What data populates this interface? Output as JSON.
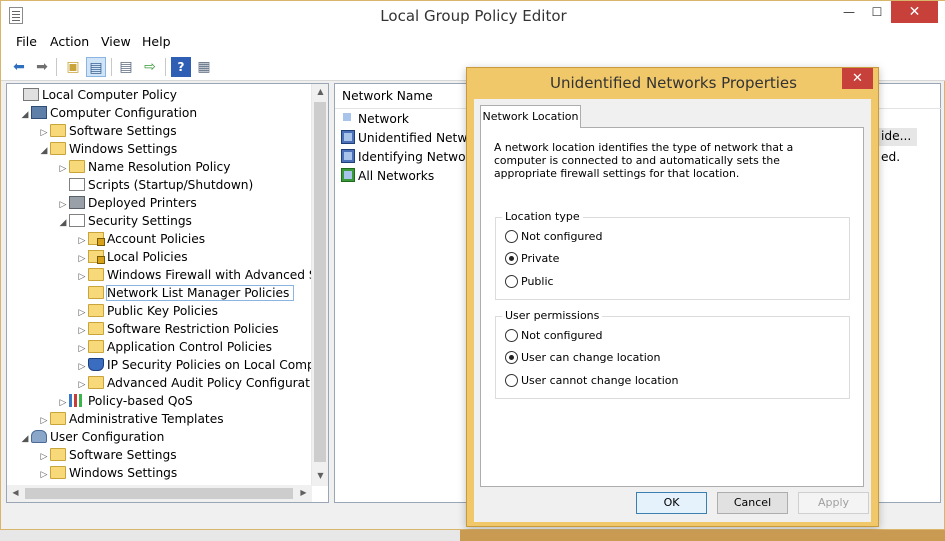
{
  "app": {
    "title": "Local Group Policy Editor",
    "min": "—",
    "max": "☐",
    "close": "✕"
  },
  "menu": [
    "File",
    "Action",
    "View",
    "Help"
  ],
  "tree": {
    "items": [
      {
        "label": "Local Computer Policy",
        "level": 0,
        "arrow": "",
        "icon": "lgp"
      },
      {
        "label": "Computer Configuration",
        "level": 1,
        "arrow": "◢",
        "icon": "computer"
      },
      {
        "label": "Software Settings",
        "level": 2,
        "arrow": "▷",
        "icon": "folder"
      },
      {
        "label": "Windows Settings",
        "level": 2,
        "arrow": "◢",
        "icon": "folder"
      },
      {
        "label": "Name Resolution Policy",
        "level": 3,
        "arrow": "▷",
        "icon": "folder"
      },
      {
        "label": "Scripts (Startup/Shutdown)",
        "level": 3,
        "arrow": "",
        "icon": "doc"
      },
      {
        "label": "Deployed Printers",
        "level": 3,
        "arrow": "▷",
        "icon": "printer"
      },
      {
        "label": "Security Settings",
        "level": 3,
        "arrow": "◢",
        "icon": "doc"
      },
      {
        "label": "Account Policies",
        "level": 4,
        "arrow": "▷",
        "icon": "folder-lock"
      },
      {
        "label": "Local Policies",
        "level": 4,
        "arrow": "▷",
        "icon": "folder-lock"
      },
      {
        "label": "Windows Firewall with Advanced Secu",
        "level": 4,
        "arrow": "▷",
        "icon": "folder"
      },
      {
        "label": "Network List Manager Policies",
        "level": 4,
        "arrow": "",
        "icon": "folder",
        "selected": true
      },
      {
        "label": "Public Key Policies",
        "level": 4,
        "arrow": "▷",
        "icon": "folder"
      },
      {
        "label": "Software Restriction Policies",
        "level": 4,
        "arrow": "▷",
        "icon": "folder"
      },
      {
        "label": "Application Control Policies",
        "level": 4,
        "arrow": "▷",
        "icon": "folder"
      },
      {
        "label": "IP Security Policies on Local Computer",
        "level": 4,
        "arrow": "▷",
        "icon": "shield"
      },
      {
        "label": "Advanced Audit Policy Configuration",
        "level": 4,
        "arrow": "▷",
        "icon": "folder"
      },
      {
        "label": "Policy-based QoS",
        "level": 3,
        "arrow": "▷",
        "icon": "chart"
      },
      {
        "label": "Administrative Templates",
        "level": 2,
        "arrow": "▷",
        "icon": "folder"
      },
      {
        "label": "User Configuration",
        "level": 1,
        "arrow": "◢",
        "icon": "user"
      },
      {
        "label": "Software Settings",
        "level": 2,
        "arrow": "▷",
        "icon": "folder"
      },
      {
        "label": "Windows Settings",
        "level": 2,
        "arrow": "▷",
        "icon": "folder"
      }
    ]
  },
  "list": {
    "column_name": "Network Name",
    "rows": [
      "Network",
      "Unidentified Networ",
      "Identifying Networks",
      "All Networks"
    ],
    "right_fragments": [
      "ide...",
      "ed."
    ]
  },
  "dialog": {
    "title": "Unidentified Networks Properties",
    "close": "✕",
    "tab": "Network Location",
    "description": "A network location identifies the type of network that a computer is connected to and automatically sets the appropriate firewall settings for that location.",
    "location_type": {
      "label": "Location type",
      "options": [
        "Not configured",
        "Private",
        "Public"
      ],
      "selected": "Private"
    },
    "user_permissions": {
      "label": "User permissions",
      "options": [
        "Not configured",
        "User can change location",
        "User cannot change location"
      ],
      "selected": "User can change location"
    },
    "buttons": {
      "ok": "OK",
      "cancel": "Cancel",
      "apply": "Apply"
    }
  }
}
